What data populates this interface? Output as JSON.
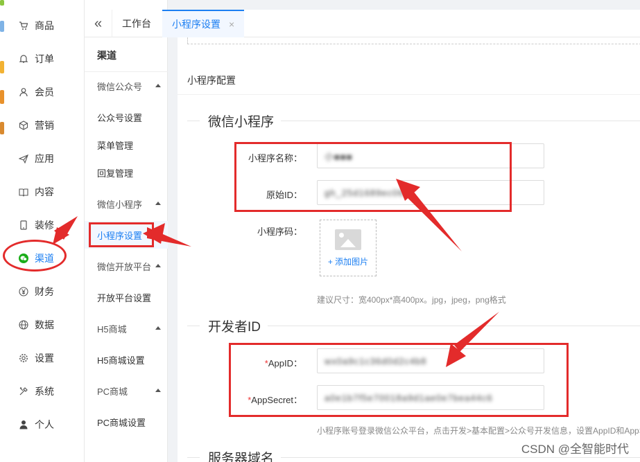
{
  "main_nav": [
    {
      "label": "商品",
      "icon": "cart-icon"
    },
    {
      "label": "订单",
      "icon": "bell-icon"
    },
    {
      "label": "会员",
      "icon": "user-icon"
    },
    {
      "label": "营销",
      "icon": "cube-icon"
    },
    {
      "label": "应用",
      "icon": "send-icon"
    },
    {
      "label": "内容",
      "icon": "book-icon"
    },
    {
      "label": "装修",
      "icon": "tablet-icon"
    },
    {
      "label": "渠道",
      "icon": "wechat-icon",
      "active": true
    },
    {
      "label": "财务",
      "icon": "yen-icon"
    },
    {
      "label": "数据",
      "icon": "globe-icon"
    },
    {
      "label": "设置",
      "icon": "gear-icon"
    },
    {
      "label": "系统",
      "icon": "tools-icon"
    },
    {
      "label": "个人",
      "icon": "person-icon"
    }
  ],
  "sub_nav": {
    "title": "渠道",
    "items": [
      {
        "label": "微信公众号",
        "group": true
      },
      {
        "label": "公众号设置"
      },
      {
        "label": "菜单管理"
      },
      {
        "label": "回复管理"
      },
      {
        "label": "微信小程序",
        "group": true
      },
      {
        "label": "小程序设置",
        "active": true
      },
      {
        "label": "微信开放平台",
        "group": true
      },
      {
        "label": "开放平台设置"
      },
      {
        "label": "H5商城",
        "group": true
      },
      {
        "label": "H5商城设置"
      },
      {
        "label": "PC商城",
        "group": true
      },
      {
        "label": "PC商城设置"
      }
    ]
  },
  "tabs": [
    {
      "label": "工作台"
    },
    {
      "label": "小程序设置",
      "active": true,
      "close": "×"
    }
  ],
  "tab_collapse": "«",
  "content": {
    "section_title": "小程序配置",
    "wechat_mini": {
      "legend": "微信小程序",
      "name_label": "小程序名称：",
      "name_value": "小■■■",
      "origin_label": "原始ID：",
      "origin_value": "gh_25d1689ec060",
      "code_label": "小程序码：",
      "upload_text": "+ 添加图片",
      "size_hint": "建议尺寸：宽400px*高400px。jpg，jpeg，png格式"
    },
    "developer": {
      "legend": "开发者ID",
      "appid_label": "AppID：",
      "appid_value": "wx0a9c1c36d0d2c4b8",
      "secret_label": "AppSecret：",
      "secret_value": "a0e1b7f5e70018a9d1ae0e7bea44c6",
      "required_mark": "*",
      "hint": "小程序账号登录微信公众平台，点击开发>基本配置>公众号开发信息，设置AppID和AppSecret"
    },
    "server": {
      "legend": "服务器域名"
    }
  },
  "watermark": "CSDN @全智能时代",
  "colors": {
    "accent": "#1c7ff2",
    "annotation": "#e32b2b",
    "wechat": "#1aad19"
  }
}
